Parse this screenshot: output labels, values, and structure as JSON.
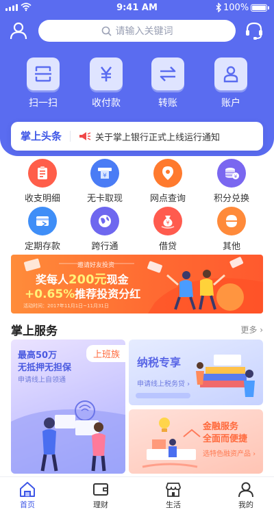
{
  "status_bar": {
    "time": "9:41 AM",
    "battery": "100%"
  },
  "search": {
    "placeholder": "请输入关键词"
  },
  "quick_actions": [
    {
      "label": "扫一扫",
      "icon": "scan-icon"
    },
    {
      "label": "收付款",
      "icon": "yen-icon"
    },
    {
      "label": "转账",
      "icon": "transfer-icon"
    },
    {
      "label": "账户",
      "icon": "account-icon"
    }
  ],
  "headline": {
    "title": "掌上头条",
    "text": "关于掌上银行正式上线运行通知"
  },
  "functions": [
    {
      "label": "收支明细",
      "color": "#ff5e4a"
    },
    {
      "label": "无卡取现",
      "color": "#4a7cf5"
    },
    {
      "label": "网点查询",
      "color": "#ff7a2e"
    },
    {
      "label": "积分兑换",
      "color": "#7a67f0"
    },
    {
      "label": "定期存款",
      "color": "#3f8ef7"
    },
    {
      "label": "跨行通",
      "color": "#6e67ef"
    },
    {
      "label": "借贷",
      "color": "#ff5b4e"
    },
    {
      "label": "其他",
      "color": "#ff8a3a"
    }
  ],
  "banner": {
    "invite": "邀请好友投资",
    "line1_prefix": "奖每人",
    "line1_amount": "200元",
    "line1_suffix": "现金",
    "line2_rate": "+0.65%",
    "line2_text": "推荐投资分红",
    "date": "活动时间：2017年11月1日~11月31日"
  },
  "services": {
    "title": "掌上服务",
    "more": "更多",
    "card_a": {
      "tag": "上班族",
      "line1": "最高50万",
      "line2": "无抵押无担保",
      "sub": "申请线上自领通"
    },
    "card_b": {
      "title": "纳税专享",
      "sub": "申请线上税务贷"
    },
    "card_c": {
      "line1": "金融服务",
      "line2": "全面而便捷",
      "sub": "选特色融资产品"
    }
  },
  "tabbar": [
    {
      "label": "首页",
      "icon": "home-icon",
      "active": true
    },
    {
      "label": "理财",
      "icon": "wallet-icon",
      "active": false
    },
    {
      "label": "生活",
      "icon": "store-icon",
      "active": false
    },
    {
      "label": "我的",
      "icon": "user-icon",
      "active": false
    }
  ],
  "colors": {
    "primary": "#5a6cf0",
    "accent": "#3c55e6",
    "orange": "#ff6b32"
  }
}
